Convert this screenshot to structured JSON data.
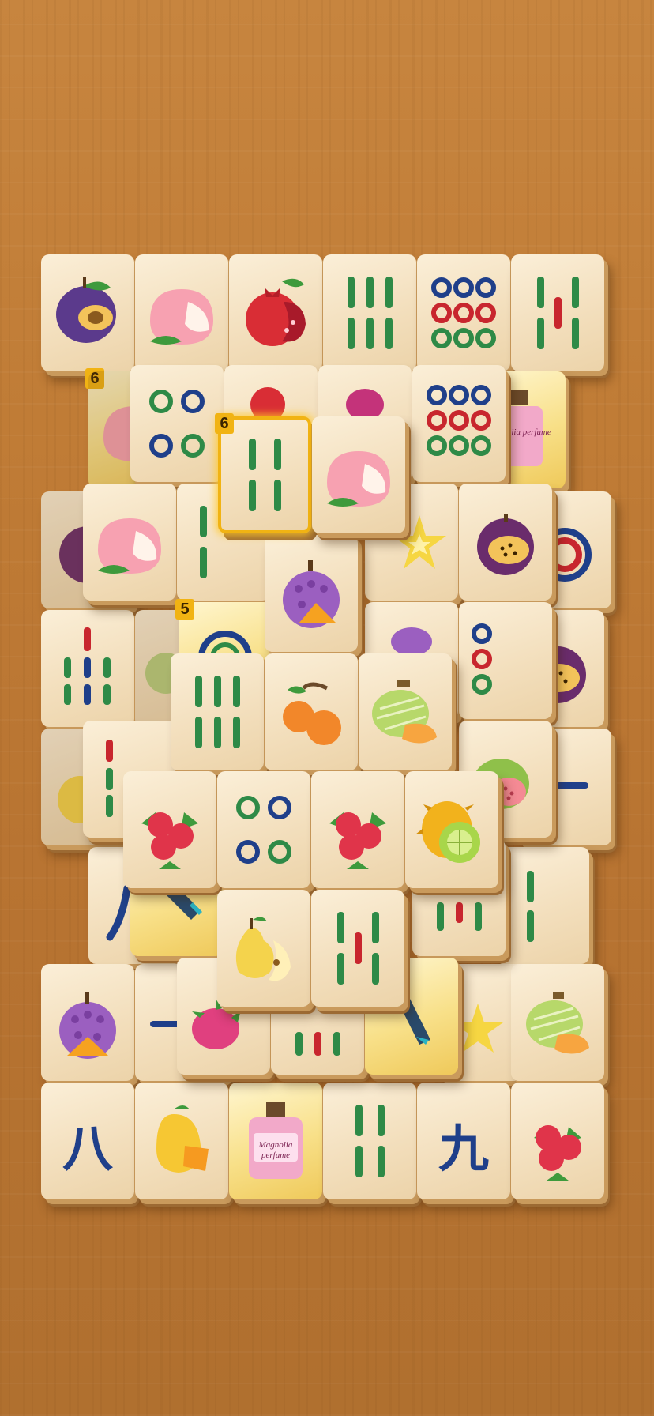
{
  "game": {
    "name": "",
    "colors": {
      "table": "#bf7b37",
      "tile": "#f3dfbd",
      "highlight": "#f1b313"
    }
  },
  "tiles": [
    {
      "id": "r1c1",
      "face": "plum"
    },
    {
      "id": "r1c2",
      "face": "peach"
    },
    {
      "id": "r1c3",
      "face": "pomegranate"
    },
    {
      "id": "r1c4",
      "face": "bamboo-6"
    },
    {
      "id": "r1c5",
      "face": "circles-9"
    },
    {
      "id": "r1c6",
      "face": "bamboo-5"
    },
    {
      "id": "r2-peach-left",
      "face": "peach",
      "badge": "6",
      "gold": true
    },
    {
      "id": "r2-circles4",
      "face": "circles-4"
    },
    {
      "id": "r2-pomegranate",
      "face": "pomegranate"
    },
    {
      "id": "r2-dragonfruit",
      "face": "dragon-fruit"
    },
    {
      "id": "r2-circles9",
      "face": "circles-9"
    },
    {
      "id": "r2-perfume",
      "face": "perfume",
      "label": "Magnolia perfume",
      "gold": true
    },
    {
      "id": "bamboo4-selected",
      "face": "bamboo-4",
      "badge": "6",
      "selected": true
    },
    {
      "id": "peach-top",
      "face": "peach"
    },
    {
      "id": "r3-peach",
      "face": "peach"
    },
    {
      "id": "r3-starfruit",
      "face": "starfruit"
    },
    {
      "id": "r3-passion",
      "face": "passion-fruit"
    },
    {
      "id": "durian-top",
      "face": "durian"
    },
    {
      "id": "r4-bamboo7",
      "face": "bamboo-7"
    },
    {
      "id": "r4-circles5",
      "face": "circles-5",
      "badge": "5",
      "gold": true
    },
    {
      "id": "r4-passion",
      "face": "passion-fruit"
    },
    {
      "id": "r5-bamboo6",
      "face": "bamboo-6"
    },
    {
      "id": "r5-loquat",
      "face": "loquat"
    },
    {
      "id": "r5-melon",
      "face": "melon"
    },
    {
      "id": "r5-guava",
      "face": "guava"
    },
    {
      "id": "r6-cranberry-a",
      "face": "cranberry"
    },
    {
      "id": "r6-circles4",
      "face": "circles-4"
    },
    {
      "id": "r6-cranberry-b",
      "face": "cranberry"
    },
    {
      "id": "r6-kiwano",
      "face": "kiwano"
    },
    {
      "id": "r7-pear",
      "face": "pear"
    },
    {
      "id": "r7-bamboo5",
      "face": "bamboo-5"
    },
    {
      "id": "r8-durian",
      "face": "durian"
    },
    {
      "id": "r8-dragonfruit",
      "face": "dragon-fruit"
    },
    {
      "id": "r8-melon",
      "face": "melon"
    },
    {
      "id": "r9-char8",
      "face": "character-8",
      "char": "八"
    },
    {
      "id": "r9-mango",
      "face": "mango"
    },
    {
      "id": "r9-perfume",
      "face": "perfume",
      "label": "Magnolia perfume",
      "gold": true
    },
    {
      "id": "r9-bamboo4",
      "face": "bamboo-4"
    },
    {
      "id": "r9-char9",
      "face": "character-9",
      "char": "九"
    },
    {
      "id": "r9-cranberry",
      "face": "cranberry"
    }
  ]
}
